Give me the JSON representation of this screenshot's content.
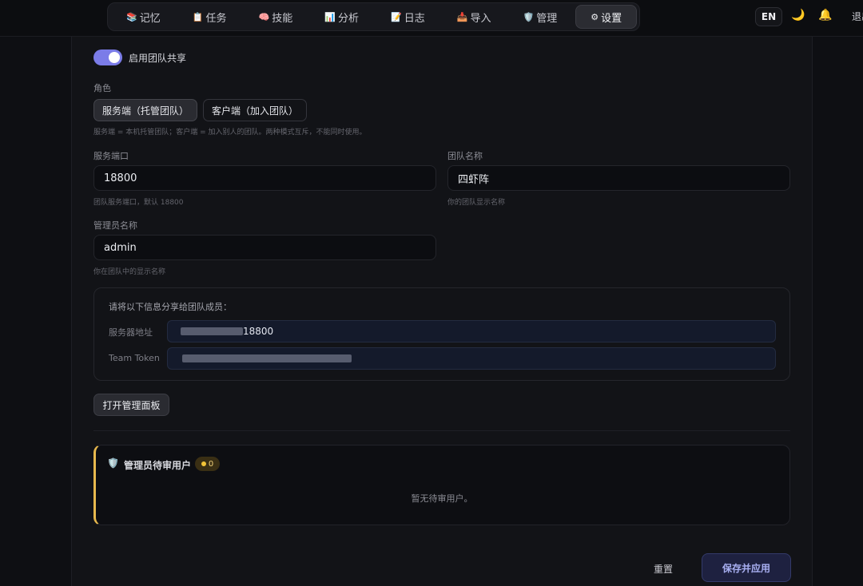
{
  "nav": {
    "items": [
      {
        "icon": "📚",
        "label": "记忆"
      },
      {
        "icon": "📋",
        "label": "任务"
      },
      {
        "icon": "🧠",
        "label": "技能"
      },
      {
        "icon": "📊",
        "label": "分析"
      },
      {
        "icon": "📝",
        "label": "日志"
      },
      {
        "icon": "📥",
        "label": "导入"
      },
      {
        "icon": "🛡️",
        "label": "管理"
      },
      {
        "icon": "⚙",
        "label": "设置"
      }
    ],
    "active": "设置"
  },
  "header": {
    "lang": "EN",
    "theme_icon": "🌙",
    "bell_icon": "🔔",
    "logout": "退出"
  },
  "team": {
    "enable_label": "启用团队共享",
    "enabled": true,
    "role_label": "角色",
    "role_server": "服务端（托管团队）",
    "role_client": "客户端（加入团队）",
    "role_hint": "服务端 = 本机托管团队；客户端 = 加入别人的团队。两种模式互斥，不能同时使用。",
    "port_label": "服务端口",
    "port_value": "18800",
    "port_hint": "团队服务端口，默认 18800",
    "team_name_label": "团队名称",
    "team_name_value": "四虾阵",
    "team_name_hint": "你的团队显示名称",
    "admin_label": "管理员名称",
    "admin_value": "admin",
    "admin_hint": "你在团队中的显示名称"
  },
  "share": {
    "title": "请将以下信息分享给团队成员：",
    "server_label": "服务器地址",
    "server_value_suffix": "18800",
    "token_label": "Team Token"
  },
  "open_panel_button": "打开管理面板",
  "pending": {
    "icon": "🛡️",
    "title": "管理员待审用户",
    "count": "0",
    "empty": "暂无待审用户。"
  },
  "footer": {
    "reset": "重置",
    "save": "保存并应用"
  },
  "colors": {
    "accent": "#7b7ce8",
    "warning": "#e7b84d",
    "background": "#0e0f13"
  }
}
